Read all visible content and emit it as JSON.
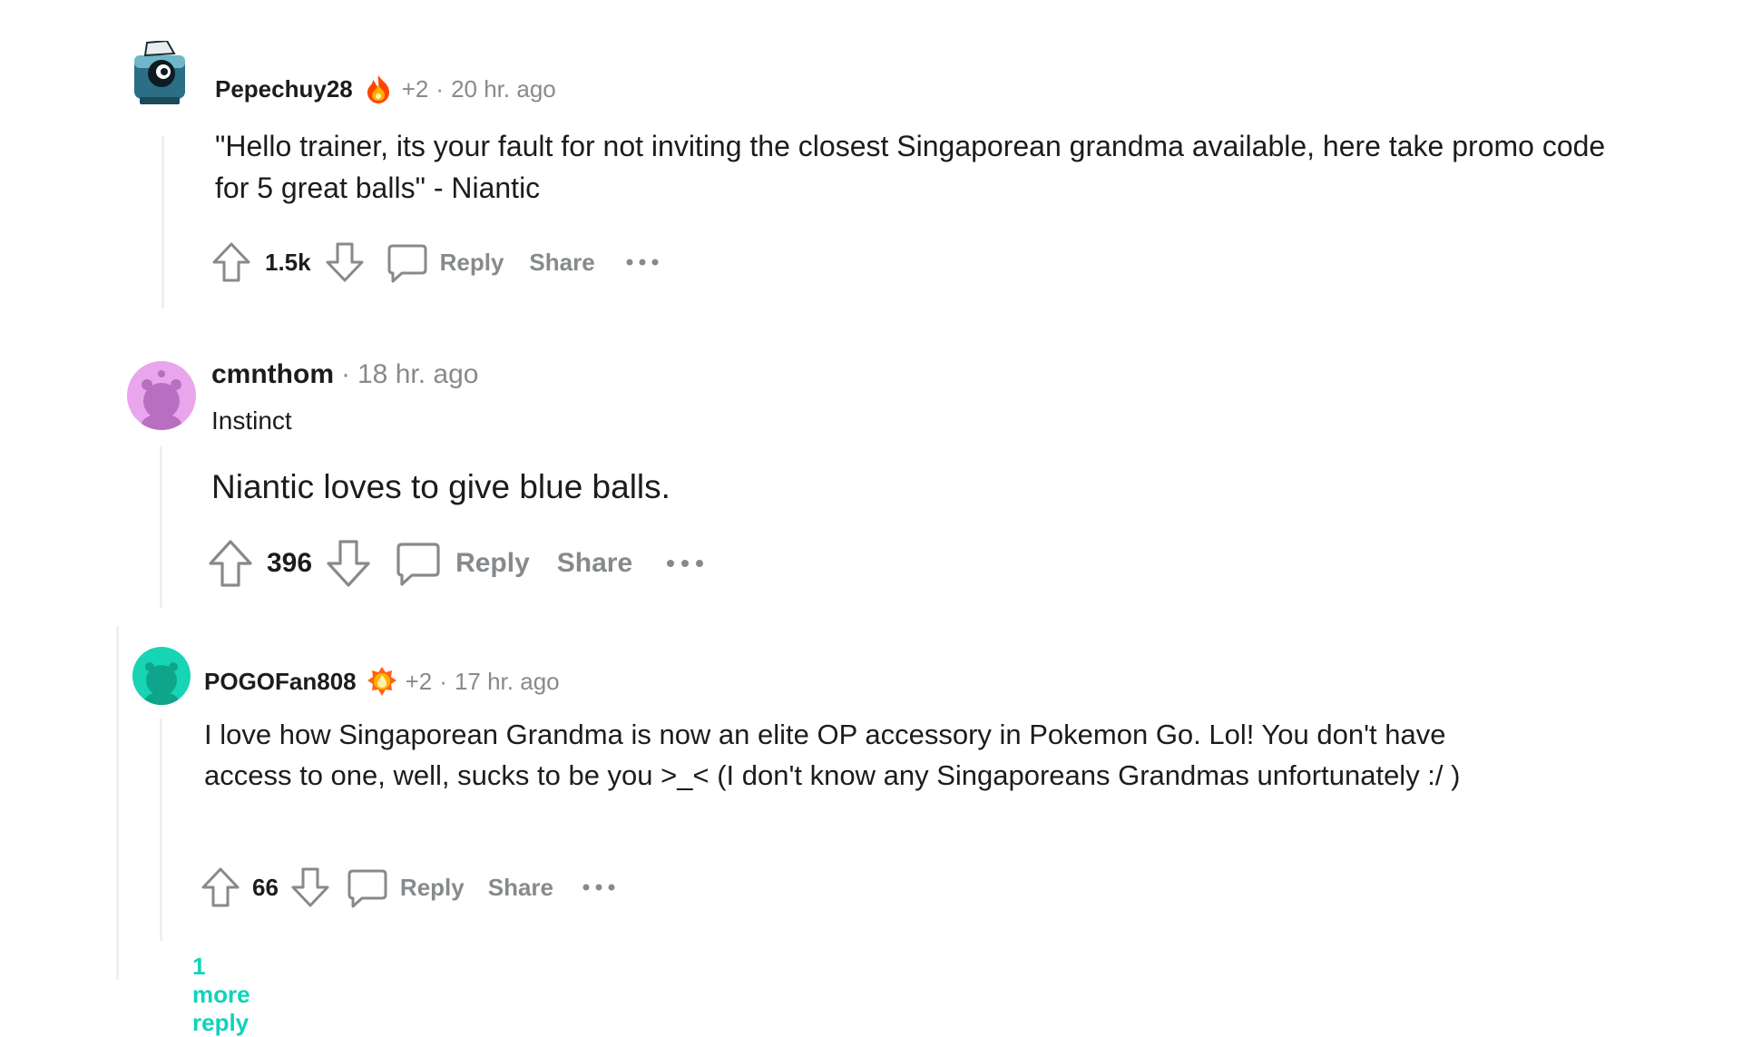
{
  "comments": [
    {
      "username": "Pepechuy28",
      "award_count": "+2",
      "separator": "·",
      "timestamp": "20 hr. ago",
      "body": "\"Hello trainer, its your fault for not inviting the closest Singaporean grandma available, here take promo code for 5 great balls\" - Niantic",
      "score": "1.5k",
      "reply_label": "Reply",
      "share_label": "Share",
      "avatar_color": "#2a6f86",
      "flair_icon": "flame-award-icon"
    },
    {
      "username": "cmnthom",
      "separator": "·",
      "timestamp": "18 hr. ago",
      "user_flair": "Instinct",
      "body": "Niantic loves to give blue balls.",
      "score": "396",
      "reply_label": "Reply",
      "share_label": "Share",
      "avatar_color": "#e9a6ec"
    },
    {
      "username": "POGOFan808",
      "award_count": "+2",
      "separator": "·",
      "timestamp": "17 hr. ago",
      "body": "I love how Singaporean Grandma is now an elite OP accessory in Pokemon Go. Lol! You don't have access to one, well, sucks to be you >_< (I don't know any Singaporeans Grandmas unfortunately :/ )",
      "score": "66",
      "reply_label": "Reply",
      "share_label": "Share",
      "more_replies": "1 more reply",
      "avatar_color": "#17d4b4",
      "flair_icon": "fire-award-icon"
    }
  ],
  "colors": {
    "muted": "#878a8c",
    "text": "#1c1c1c",
    "accent": "#0dd3bb",
    "thread_line": "#edeff1"
  }
}
